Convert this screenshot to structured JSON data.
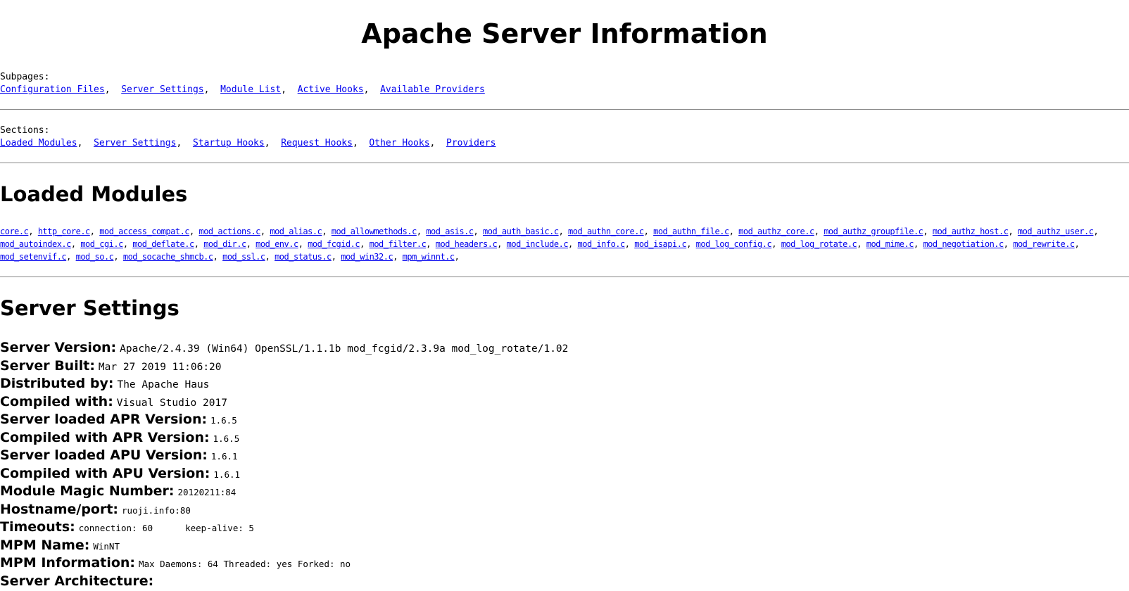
{
  "page_title": "Apache Server Information",
  "subpages": {
    "label": "Subpages:",
    "links": [
      "Configuration Files",
      "Server Settings",
      "Module List",
      "Active Hooks",
      "Available Providers"
    ]
  },
  "sections": {
    "label": "Sections:",
    "links": [
      "Loaded Modules",
      "Server Settings",
      "Startup Hooks",
      "Request Hooks",
      "Other Hooks",
      "Providers"
    ]
  },
  "loaded_modules": {
    "heading": "Loaded Modules",
    "modules": [
      "core.c",
      "http_core.c",
      "mod_access_compat.c",
      "mod_actions.c",
      "mod_alias.c",
      "mod_allowmethods.c",
      "mod_asis.c",
      "mod_auth_basic.c",
      "mod_authn_core.c",
      "mod_authn_file.c",
      "mod_authz_core.c",
      "mod_authz_groupfile.c",
      "mod_authz_host.c",
      "mod_authz_user.c",
      "mod_autoindex.c",
      "mod_cgi.c",
      "mod_deflate.c",
      "mod_dir.c",
      "mod_env.c",
      "mod_fcgid.c",
      "mod_filter.c",
      "mod_headers.c",
      "mod_include.c",
      "mod_info.c",
      "mod_isapi.c",
      "mod_log_config.c",
      "mod_log_rotate.c",
      "mod_mime.c",
      "mod_negotiation.c",
      "mod_rewrite.c",
      "mod_setenvif.c",
      "mod_so.c",
      "mod_socache_shmcb.c",
      "mod_ssl.c",
      "mod_status.c",
      "mod_win32.c",
      "mpm_winnt.c"
    ]
  },
  "server_settings": {
    "heading": "Server Settings",
    "server_version": {
      "label": "Server Version:",
      "value": "Apache/2.4.39 (Win64) OpenSSL/1.1.1b mod_fcgid/2.3.9a mod_log_rotate/1.02"
    },
    "server_built": {
      "label": "Server Built:",
      "value": "Mar 27 2019 11:06:20"
    },
    "distributed_by": {
      "label": "Distributed by:",
      "value": "The Apache Haus"
    },
    "compiled_with": {
      "label": "Compiled with:",
      "value": "Visual Studio 2017"
    },
    "loaded_apr": {
      "label": "Server loaded APR Version:",
      "value": "1.6.5"
    },
    "compiled_apr": {
      "label": "Compiled with APR Version:",
      "value": "1.6.5"
    },
    "loaded_apu": {
      "label": "Server loaded APU Version:",
      "value": "1.6.1"
    },
    "compiled_apu": {
      "label": "Compiled with APU Version:",
      "value": "1.6.1"
    },
    "magic_number": {
      "label": "Module Magic Number:",
      "value": "20120211:84"
    },
    "hostname_port": {
      "label": "Hostname/port:",
      "value": "ruoji.info:80"
    },
    "timeouts": {
      "label": "Timeouts:",
      "connection": "connection: 60",
      "keep_alive": "keep-alive: 5"
    },
    "mpm_name": {
      "label": "MPM Name:",
      "value": "WinNT"
    },
    "mpm_information": {
      "label": "MPM Information:",
      "value": "Max Daemons: 64 Threaded: yes Forked: no"
    },
    "server_architecture": {
      "label": "Server Architecture:"
    }
  }
}
